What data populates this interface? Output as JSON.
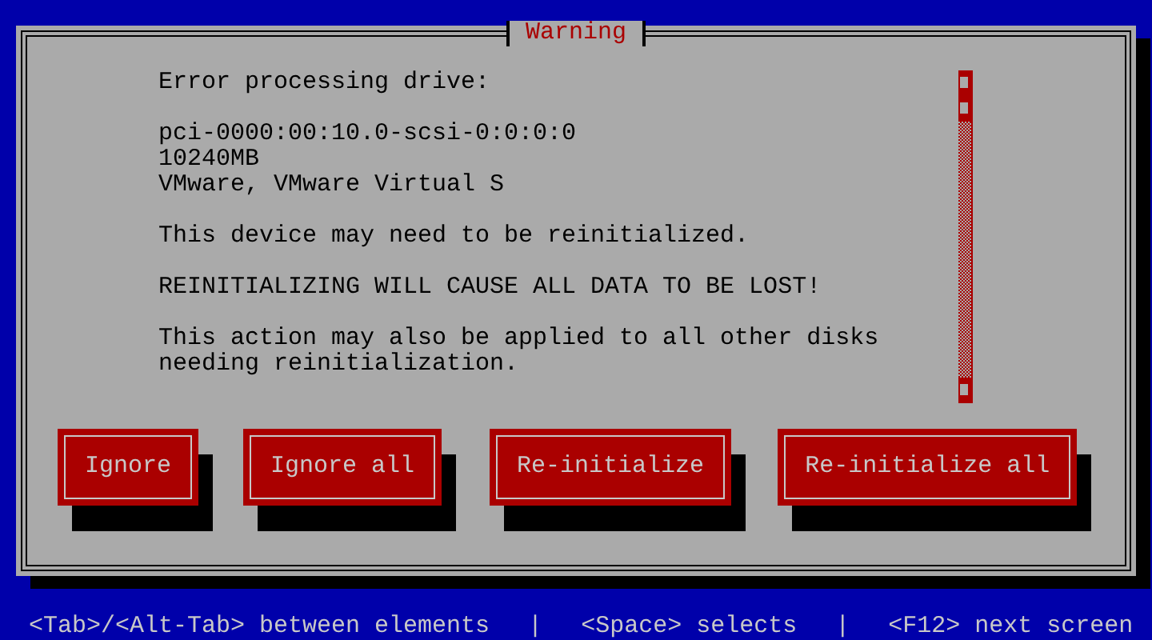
{
  "dialog": {
    "title": "Warning",
    "paragraphs": [
      [
        "Error processing drive:"
      ],
      [
        "pci-0000:00:10.0-scsi-0:0:0:0",
        "10240MB",
        "VMware, VMware Virtual S"
      ],
      [
        "This device may need to be reinitialized."
      ],
      [
        "REINITIALIZING WILL CAUSE ALL DATA TO BE LOST!"
      ],
      [
        "This action may also be applied to all other disks",
        "needing reinitialization."
      ]
    ],
    "buttons": [
      "Ignore",
      "Ignore all",
      "Re-initialize",
      "Re-initialize all"
    ]
  },
  "status_bar": [
    {
      "kind": "hint",
      "text": "<Tab>/<Alt-Tab> between elements"
    },
    {
      "kind": "separator",
      "text": "|"
    },
    {
      "kind": "hint",
      "text": "<Space> selects"
    },
    {
      "kind": "separator",
      "text": "|"
    },
    {
      "kind": "hint",
      "text": "<F12> next screen"
    }
  ]
}
